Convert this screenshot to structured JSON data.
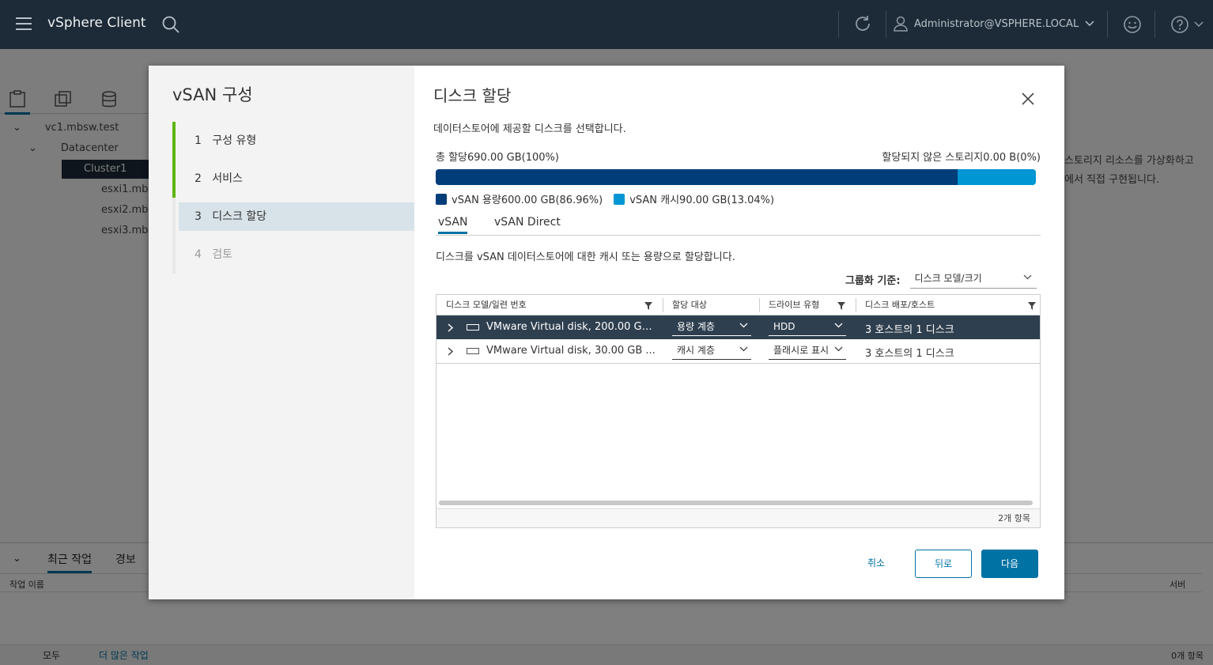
{
  "header": {
    "app_title": "vSphere Client",
    "user": "Administrator@VSPHERE.LOCAL"
  },
  "inventory": {
    "items": [
      {
        "label": "vc1.mbsw.test"
      },
      {
        "label": "Datacenter"
      },
      {
        "label": "Cluster1"
      },
      {
        "label": "esxi1.mbsw"
      },
      {
        "label": "esxi2.mbs"
      },
      {
        "label": "esxi3.mbs"
      }
    ]
  },
  "background": {
    "right_text_1": "스토리지 리소스를 가상화하고",
    "right_text_2": "에서 직접 구현됩니다.",
    "recent_tab": "최근 작업",
    "alarms_tab": "경보",
    "col_task_name": "작업 이름",
    "col_server": "서버",
    "filter_all": "모두",
    "more_tasks": "더 많은 작업",
    "item_count": "0개 항목"
  },
  "wizard": {
    "title": "vSAN 구성",
    "steps": [
      {
        "num": "1",
        "label": "구성 유형"
      },
      {
        "num": "2",
        "label": "서비스"
      },
      {
        "num": "3",
        "label": "디스크 할당"
      },
      {
        "num": "4",
        "label": "검토"
      }
    ]
  },
  "page": {
    "heading": "디스크 할당",
    "description": "데이터스토어에 제공할 디스크를 선택합니다.",
    "total_alloc": "총 할당690.00 GB(100%)",
    "unalloc": "할당되지 않은 스토리지0.00 B(0%)",
    "capacity_fraction": 0.8696,
    "cache_fraction": 0.1304,
    "legend_capacity": "vSAN 용량600.00 GB(86.96%)",
    "legend_cache": "vSAN 캐시90.00 GB(13.04%)",
    "color_capacity": "#003d79",
    "color_cache": "#0095d3",
    "tab_vsan": "vSAN",
    "tab_vsan_direct": "vSAN Direct",
    "tab_description": "디스크를 vSAN 데이터스토어에 대한 캐시 또는 용량으로 할당합니다.",
    "grouping_label": "그룹화 기준:",
    "grouping_value": "디스크 모델/크기"
  },
  "table": {
    "columns": [
      "디스크 모델/일련 번호",
      "할당 대상",
      "드라이브 유형",
      "디스크 배포/호스트"
    ],
    "rows": [
      {
        "model": "VMware Virtual disk, 200.00 GB...",
        "claim": "용량 계층",
        "drive": "HDD",
        "dist": "3 호스트의 1 디스크"
      },
      {
        "model": "VMware Virtual disk, 30.00 GB ...",
        "claim": "캐시 계층",
        "drive": "플래시로 표시",
        "dist": "3 호스트의 1 디스크"
      }
    ],
    "footer": "2개 항목"
  },
  "buttons": {
    "cancel": "취소",
    "back": "뒤로",
    "next": "다음"
  }
}
